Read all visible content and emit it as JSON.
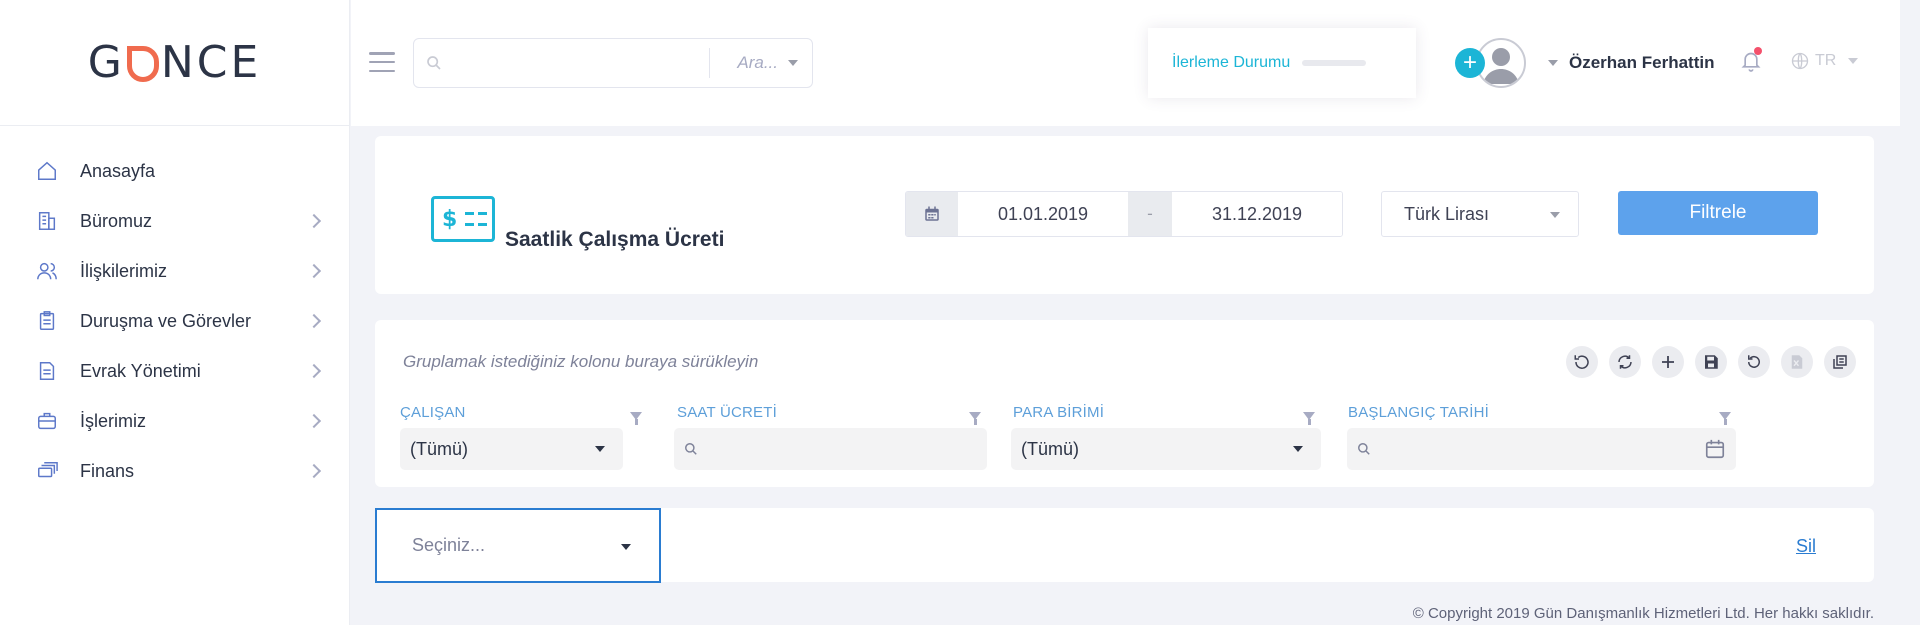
{
  "app": {
    "logo_text_left": "G",
    "logo_text_right": "NCE",
    "brand_color": "#f06b4e"
  },
  "sidebar": {
    "items": [
      {
        "label": "Anasayfa",
        "icon": "home-icon",
        "has_children": false
      },
      {
        "label": "Büromuz",
        "icon": "building-icon",
        "has_children": true
      },
      {
        "label": "İlişkilerimiz",
        "icon": "users-icon",
        "has_children": true
      },
      {
        "label": "Duruşma ve Görevler",
        "icon": "clipboard-icon",
        "has_children": true
      },
      {
        "label": "Evrak Yönetimi",
        "icon": "document-icon",
        "has_children": true
      },
      {
        "label": "İşlerimiz",
        "icon": "briefcase-icon",
        "has_children": true
      },
      {
        "label": "Finans",
        "icon": "money-stack-icon",
        "has_children": true
      }
    ]
  },
  "header": {
    "search": {
      "value": "",
      "placeholder": "",
      "scope_label": "Ara..."
    },
    "progress": {
      "label": "İlerleme Durumu",
      "value_pct": 0
    },
    "user_name": "Özerhan Ferhattin",
    "language": "TR",
    "accent_color": "#1cb5d6"
  },
  "page": {
    "title": "Saatlik Çalışma Ücreti",
    "date_start": "01.01.2019",
    "date_separator": "-",
    "date_end": "31.12.2019",
    "currency": "Türk Lirası",
    "filter_button": "Filtrele"
  },
  "grid": {
    "group_hint": "Gruplamak istediğiniz kolonu buraya sürükleyin",
    "toolbar": [
      "undo-icon",
      "refresh-icon",
      "add-icon",
      "save-icon",
      "revert-icon",
      "excel-export-icon",
      "copy-icon"
    ],
    "columns": [
      {
        "title": "ÇALIŞAN",
        "filter_value": "(Tümü)",
        "filter_type": "select"
      },
      {
        "title": "SAAT ÜCRETİ",
        "filter_value": "",
        "filter_type": "search"
      },
      {
        "title": "PARA BİRİMİ",
        "filter_value": "(Tümü)",
        "filter_type": "select"
      },
      {
        "title": "BAŞLANGIÇ TARİHİ",
        "filter_value": "",
        "filter_type": "date"
      }
    ]
  },
  "bottom": {
    "select_placeholder": "Seçiniz...",
    "delete_link": "Sil"
  },
  "footer": {
    "copyright": "© Copyright 2019 Gün Danışmanlık Hizmetleri Ltd. Her hakkı saklıdır."
  }
}
